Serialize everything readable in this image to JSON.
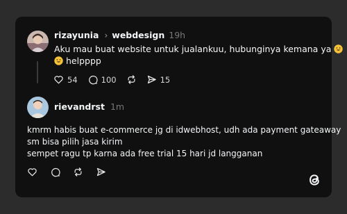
{
  "post": {
    "username": "rizayunia",
    "topic": "webdesign",
    "time": "19h",
    "line1": "Aku mau buat website untuk jualankuu, hubunginya kemana ya",
    "line2": "helpppp",
    "likes": "54",
    "replies": "100",
    "shares": "15"
  },
  "reply": {
    "username": "rievandrst",
    "time": "1m",
    "lines": [
      "kmrm habis buat e-commerce jg di idwebhost, udh ada payment gateaway",
      "sm bisa pilih jasa kirim",
      "sempet ragu tp karna ada free trial 15 hari jd langganan"
    ]
  },
  "icons": {
    "like": "heart-icon",
    "reply": "comment-icon",
    "repost": "repost-icon",
    "share": "send-icon",
    "brand": "threads-logo"
  },
  "colors": {
    "background": "#2c2c2c",
    "card": "#101010",
    "text": "#f3f5f7",
    "muted": "#777777"
  }
}
